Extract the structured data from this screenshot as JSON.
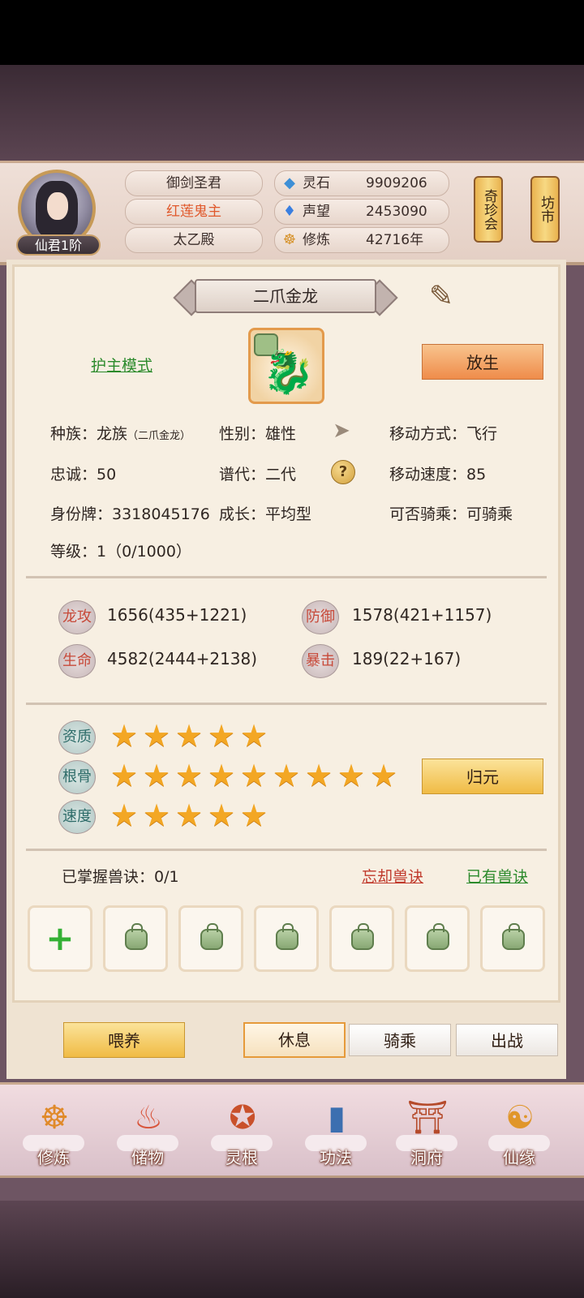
{
  "header": {
    "avatar_rank": "仙君1阶",
    "titles": [
      "御剑圣君",
      "红莲鬼主",
      "太乙殿"
    ],
    "resources": [
      {
        "label": "灵石",
        "value": "9909206",
        "icon": "spirit-stone-icon"
      },
      {
        "label": "声望",
        "value": "2453090",
        "icon": "crystal-icon"
      },
      {
        "label": "修炼",
        "value": "42716年",
        "icon": "meditation-icon"
      }
    ],
    "side_buttons": [
      "奇珍会",
      "坊市"
    ]
  },
  "pet": {
    "name": "二爪金龙",
    "mode_link": "护主模式",
    "release_button": "放生",
    "species_label": "种族：",
    "species_value": "龙族",
    "species_sub": "（二爪金龙）",
    "gender": "性别：雄性",
    "move_type": "移动方式：飞行",
    "loyalty": "忠诚：50",
    "generation": "谱代：二代",
    "move_speed": "移动速度：85",
    "id_tag": "身份牌：3318045176",
    "growth": "成长：平均型",
    "rideable": "可否骑乘：可骑乘",
    "level": "等级：1（0/1000）"
  },
  "stats": [
    {
      "badge": "龙攻",
      "value": "1656(435+1221)"
    },
    {
      "badge": "防御",
      "value": "1578(421+1157)"
    },
    {
      "badge": "生命",
      "value": "4582(2444+2138)"
    },
    {
      "badge": "暴击",
      "value": "189(22+167)"
    }
  ],
  "ratings": [
    {
      "badge": "资质",
      "stars": 5
    },
    {
      "badge": "根骨",
      "stars": 9
    },
    {
      "badge": "速度",
      "stars": 5
    }
  ],
  "return_button": "归元",
  "skills": {
    "mastered": "已掌握兽诀：0/1",
    "forget_link": "忘却兽诀",
    "owned_link": "已有兽诀",
    "slots": [
      "add",
      "locked",
      "locked",
      "locked",
      "locked",
      "locked",
      "locked"
    ]
  },
  "actions": {
    "feed": "喂养",
    "rest": "休息",
    "ride": "骑乘",
    "battle": "出战"
  },
  "nav": [
    {
      "label": "修炼",
      "icon": "cultivation-icon"
    },
    {
      "label": "储物",
      "icon": "storage-bag-icon"
    },
    {
      "label": "灵根",
      "icon": "spirit-root-icon"
    },
    {
      "label": "功法",
      "icon": "technique-book-icon"
    },
    {
      "label": "洞府",
      "icon": "cave-mansion-icon"
    },
    {
      "label": "仙缘",
      "icon": "fate-gourd-icon"
    }
  ],
  "colors": {
    "accent_orange": "#ef8c4a",
    "star": "#f3a724",
    "link_green": "#2b8a2b",
    "link_red": "#c0392b"
  }
}
